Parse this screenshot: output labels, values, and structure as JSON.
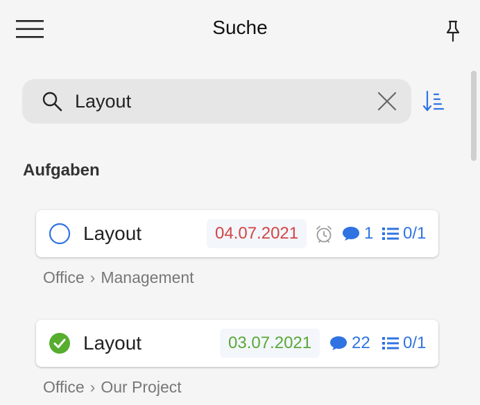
{
  "header": {
    "title": "Suche"
  },
  "search": {
    "query": "Layout"
  },
  "section": {
    "title": "Aufgaben"
  },
  "tasks": [
    {
      "title": "Layout",
      "done": false,
      "date": "04.07.2021",
      "date_color": "#d24545",
      "has_reminder": true,
      "comments": "1",
      "checklist": "0/1",
      "path": [
        "Office",
        "Management"
      ]
    },
    {
      "title": "Layout",
      "done": true,
      "date": "03.07.2021",
      "date_color": "#5aa83a",
      "has_reminder": false,
      "comments": "22",
      "checklist": "0/1",
      "path": [
        "Office",
        "Our Project"
      ]
    }
  ],
  "colors": {
    "accent": "#2f73e3",
    "done": "#56ad2e",
    "overdue": "#d24545"
  }
}
